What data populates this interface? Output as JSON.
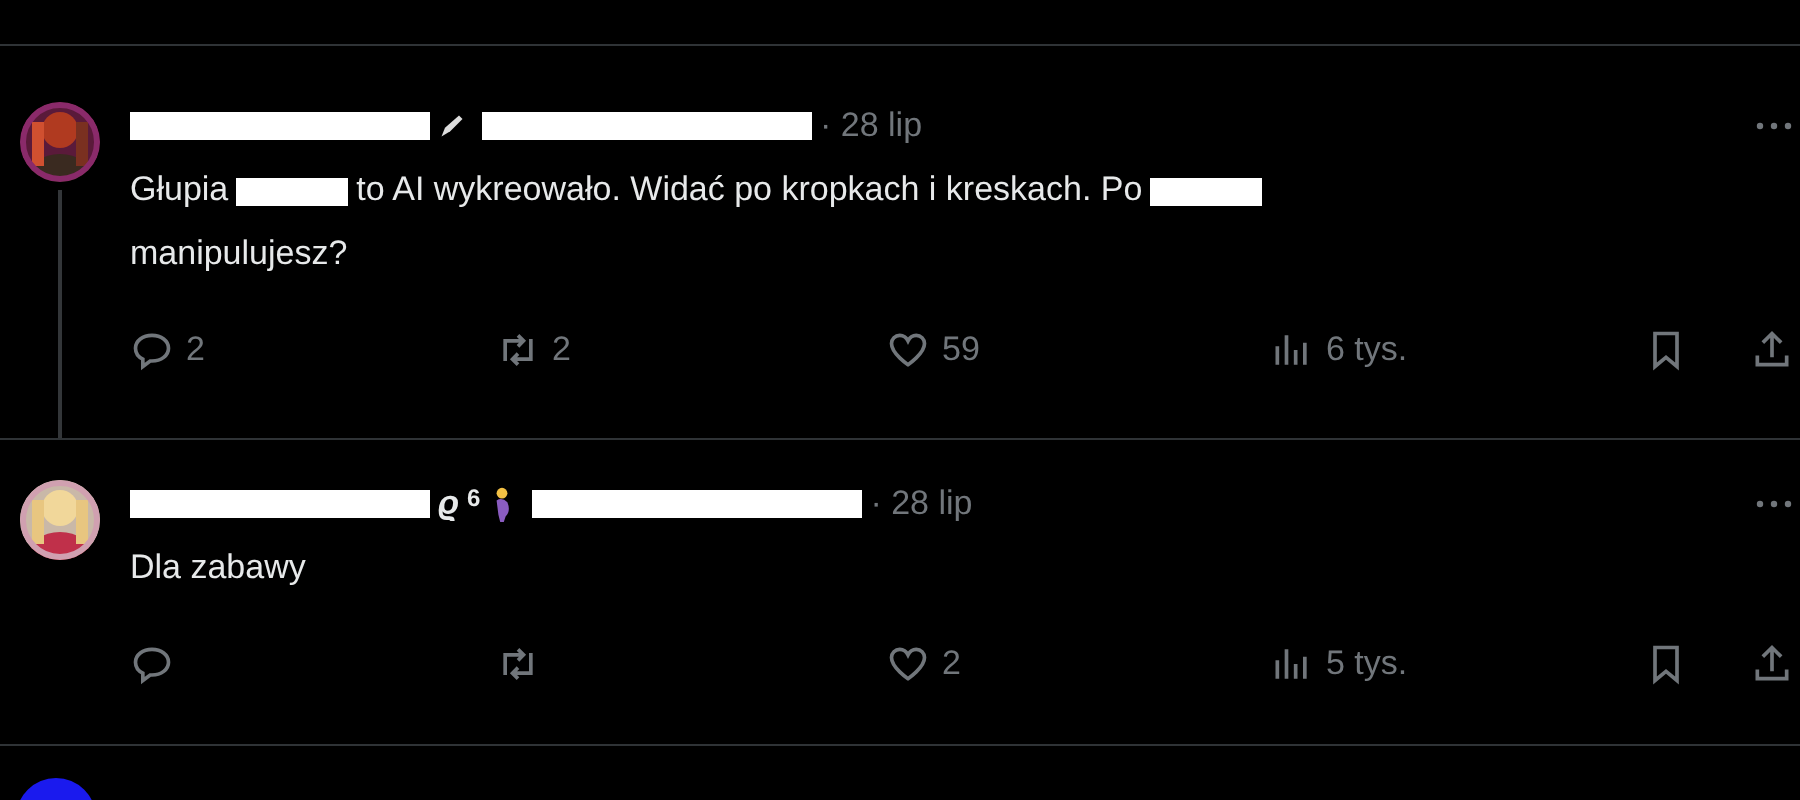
{
  "tweets": [
    {
      "thread_line": true,
      "date": "· 28 lip",
      "body": [
        {
          "kind": "text",
          "text": "Głupia"
        },
        {
          "kind": "redacted"
        },
        {
          "kind": "text",
          "text": "to AI wykreowało. Widać po kropkach i kreskach. Po"
        },
        {
          "kind": "redacted"
        },
        {
          "kind": "break"
        },
        {
          "kind": "text",
          "text": "manipulujesz?"
        }
      ],
      "stats": {
        "reply": "2",
        "retweet": "2",
        "like": "59",
        "views": "6 tys."
      }
    },
    {
      "thread_line": false,
      "name_suffix": "ϱ",
      "name_badge": "6",
      "date": "· 28 lip",
      "body": [
        {
          "kind": "text",
          "text": "Dla zabawy"
        }
      ],
      "stats": {
        "like": "2",
        "views": "5 tys."
      }
    }
  ]
}
